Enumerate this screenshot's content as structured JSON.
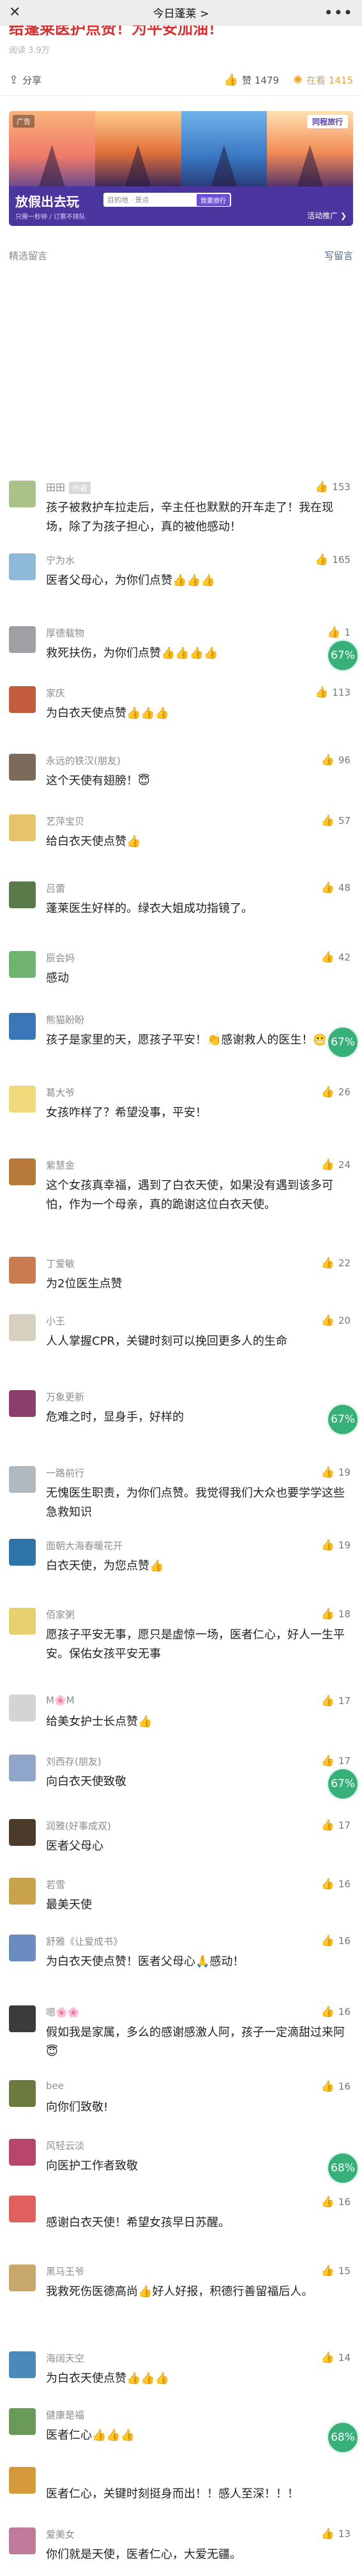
{
  "topbar": {
    "close": "✕",
    "title": "今日蓬莱 >",
    "more": "•••"
  },
  "article": {
    "headline": "给蓬莱医护点赞！为平安加油！",
    "reads": "阅读 3.9万"
  },
  "actions": {
    "share": "分享",
    "like": "赞 1479",
    "wow": "在看 1415"
  },
  "ad": {
    "tag": "广告",
    "brand": "同程旅行",
    "slogan": "放假出去玩",
    "search_placeholder": "目的地 · 景点",
    "search_button": "我要旅行",
    "sub": "只需一秒钟 / 订票不排队",
    "promo": "活动推广 ❯"
  },
  "comments_header": {
    "title": "精选留言",
    "write": "写留言"
  },
  "author_tag": "作者",
  "badge_percent": "67%",
  "badge_percent2": "68%",
  "comments": [
    {
      "name": "田田",
      "author": true,
      "likes": "153",
      "text": "孩子被救护车拉走后，辛主任也默默的开车走了！我在现场，除了为孩子担心，真的被他感动！",
      "avatar": "#a8c28a"
    },
    {
      "name": "宁为水",
      "likes": "165",
      "text": "医者父母心，为你们点赞👍👍👍",
      "avatar": "#8fb9d8"
    },
    {
      "name": "厚德载物",
      "likes": "1",
      "text": "救死扶伤，为你们点赞👍👍👍👍",
      "avatar": "#9ea0a3"
    },
    {
      "name": "家庆",
      "likes": "113",
      "text": "为白衣天使点赞👍👍👍",
      "avatar": "#c35c3c"
    },
    {
      "name": "永远的铁汉(朋友)",
      "likes": "96",
      "text": "这个天使有翅膀！😇",
      "avatar": "#7d6a5a"
    },
    {
      "name": "艺萍宝贝",
      "likes": "57",
      "text": "给白衣天使点赞👍",
      "avatar": "#e6c46b"
    },
    {
      "name": "吕蕾",
      "likes": "48",
      "text": "蓬莱医生好样的。绿衣大姐成功指镜了。",
      "avatar": "#5a7a4a"
    },
    {
      "name": "辰会妈",
      "likes": "42",
      "text": "感动",
      "avatar": "#6fb36f"
    },
    {
      "name": "熊猫盼盼",
      "likes": "",
      "text": "孩子是家里的天，愿孩子平安！👏感谢救人的医生！😬",
      "avatar": "#3a76b8"
    },
    {
      "name": "葛大爷",
      "likes": "26",
      "text": "女孩咋样了？希望没事，平安！",
      "avatar": "#f0d97a"
    },
    {
      "name": "紫慧金",
      "likes": "24",
      "text": "这个女孩真幸福，遇到了白衣天使，如果没有遇到该多可怕，作为一个母亲，真的跪谢这位白衣天使。",
      "avatar": "#b87a3a"
    },
    {
      "name": "丁爱敏",
      "likes": "22",
      "text": "为2位医生点赞",
      "avatar": "#c97b52"
    },
    {
      "name": "小王",
      "likes": "20",
      "text": "人人掌握CPR，关键时刻可以挽回更多人的生命",
      "avatar": "#d8d0c0"
    },
    {
      "name": "万象更新",
      "likes": "",
      "text": "危难之时，显身手，好样的",
      "avatar": "#8c3d6a"
    },
    {
      "name": "一路前行",
      "likes": "19",
      "text": "无愧医生职责，为你们点赞。我觉得我们大众也要学学这些急救知识",
      "avatar": "#b0b8c0"
    },
    {
      "name": "面朝大海春暖花开",
      "likes": "19",
      "text": "白衣天使，为您点赞👍",
      "avatar": "#2f74a8"
    },
    {
      "name": "佰家粥",
      "likes": "18",
      "text": "愿孩子平安无事，愿只是虚惊一场，医者仁心，好人一生平安。保佑女孩平安无事",
      "avatar": "#e8d070"
    },
    {
      "name": "M🌸M",
      "likes": "17",
      "text": "给美女护士长点赞👍",
      "avatar": "#d4d4d4"
    },
    {
      "name": "刘西存(朋友)",
      "likes": "17",
      "text": "向白衣天使致敬",
      "avatar": "#8fa6c9"
    },
    {
      "name": "润雅(好事成双)",
      "likes": "17",
      "text": "医者父母心",
      "avatar": "#4b3b2a"
    },
    {
      "name": "若雪",
      "likes": "16",
      "text": "最美天使",
      "avatar": "#c9a24d"
    },
    {
      "name": "舒雅《让爱成书》",
      "likes": "16",
      "text": "为白衣天使点赞！医者父母心🙏感动！",
      "avatar": "#6a8cbf"
    },
    {
      "name": "嗯🌸🌸",
      "likes": "16",
      "text": "假如我是家属，多么的感谢感激人阿，孩子一定滴甜过来阿😇",
      "avatar": "#3b3b3b"
    },
    {
      "name": "bee",
      "likes": "16",
      "text": "向你们致敬!",
      "avatar": "#6b7a3f"
    },
    {
      "name": "风轻云淡",
      "likes": "",
      "text": "向医护工作者致敬",
      "avatar": "#b8456a"
    },
    {
      "name": "",
      "likes": "16",
      "text": "感谢白衣天使！希望女孩早日苏醒。",
      "avatar": "#e06060"
    },
    {
      "name": "黑马王爷",
      "likes": "15",
      "text": "我救死伤医德高尚👍好人好报，积德行善留福后人。",
      "avatar": "#c8a86a"
    },
    {
      "name": "海阔天空",
      "likes": "14",
      "text": "为白衣天使点赞👍👍👍",
      "avatar": "#4a8ab8"
    },
    {
      "name": "健康是福",
      "likes": "",
      "text": "医者仁心👍👍👍",
      "avatar": "#6a9a5a"
    },
    {
      "name": "",
      "likes": "",
      "text": "医者仁心，关键时刻挺身而出！！感人至深！！！",
      "avatar": "#d59a3a"
    },
    {
      "name": "爱美女",
      "likes": "13",
      "text": "你们就是天使，医者仁心，大爱无疆。",
      "avatar": "#c07a9a"
    }
  ]
}
